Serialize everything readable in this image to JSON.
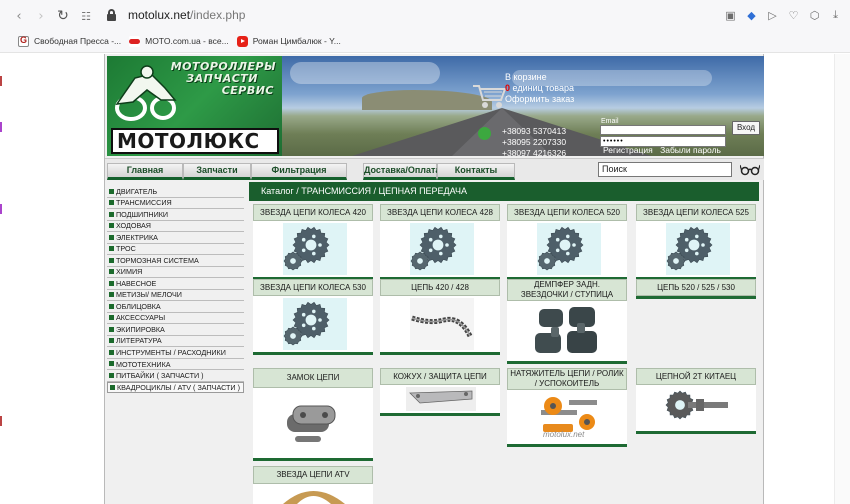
{
  "browser": {
    "url_host": "motolux.net",
    "url_path": "/index.php",
    "bookmarks": [
      {
        "label": "Свободная Пресса -...",
        "icon": "svpressa-favicon"
      },
      {
        "label": "MOTO.com.ua - все...",
        "icon": "moto-favicon"
      },
      {
        "label": "Роман Цимбалюк - Y...",
        "icon": "youtube-favicon"
      }
    ],
    "icons": [
      "camera-icon",
      "shield-icon",
      "play-icon",
      "heart-icon",
      "cube-icon",
      "download-icon"
    ]
  },
  "header": {
    "logo_line1": "МОТОРОЛЛЕРЫ",
    "logo_line2": "ЗАПЧАСТИ",
    "logo_line3": "СЕРВИС",
    "logo_word": "МОТОЛЮКС",
    "basket": {
      "title": "В корзине",
      "count": "0",
      "items_text": " единиц товара",
      "checkout": "Оформить заказ"
    },
    "phones": [
      "+38093 5370413",
      "+38095 2207330",
      "+38097 4216326"
    ],
    "login": {
      "email_label": "Email",
      "password_value": "••••••",
      "login_button": "Вход",
      "register": "Регистрация",
      "forgot": "Забыли пароль"
    }
  },
  "nav": {
    "items": [
      "Главная",
      "Запчасти",
      "Фильтрация",
      "Доставка/Оплата",
      "Контакты"
    ],
    "search_placeholder": "Поиск"
  },
  "sidebar": {
    "items": [
      "ДВИГАТЕЛЬ",
      "ТРАНСМИССИЯ",
      "ПОДШИПНИКИ",
      "ХОДОВАЯ",
      "ЭЛЕКТРИКА",
      "ТРОС",
      "ТОРМОЗНАЯ СИСТЕМА",
      "ХИМИЯ",
      "НАВЕСНОЕ",
      "МЕТИЗЫ/ МЕЛОЧИ",
      "ОБЛИЦОВКА",
      "АКСЕССУАРЫ",
      "ЭКИПИРОВКА",
      "ЛИТЕРАТУРА",
      "ИНСТРУМЕНТЫ / РАСХОДНИКИ",
      "МОТОТЕХНИКА",
      "ПИТБАЙКИ ( ЗАПЧАСТИ )",
      "КВАДРОЦИКЛЫ / ATV ( ЗАПЧАСТИ )"
    ]
  },
  "breadcrumb": "Каталог /  ТРАНСМИССИЯ /  ЦЕПНАЯ ПЕРЕДАЧА",
  "products": [
    {
      "title": "ЗВЕЗДА ЦЕПИ КОЛЕСА 420",
      "image": "sprocket-image"
    },
    {
      "title": "ЗВЕЗДА ЦЕПИ КОЛЕСА 428",
      "image": "sprocket-image"
    },
    {
      "title": "ЗВЕЗДА ЦЕПИ КОЛЕСА 520",
      "image": "sprocket-image"
    },
    {
      "title": "ЗВЕЗДА ЦЕПИ КОЛЕСА 525",
      "image": "sprocket-image"
    },
    {
      "title": "ЗВЕЗДА ЦЕПИ КОЛЕСА 530",
      "image": "sprocket-image"
    },
    {
      "title": "ЦЕПЬ 420 / 428",
      "image": "chain-image"
    },
    {
      "title": "ДЕМПФЕР ЗАДН. ЗВЕЗДОЧКИ / СТУПИЦА",
      "image": "damper-image"
    },
    {
      "title": "ЦЕПЬ 520 / 525 / 530",
      "image": ""
    },
    {
      "title": "ЗАМОК ЦЕПИ",
      "image": "chain-lock-image"
    },
    {
      "title": "КОЖУХ / ЗАЩИТА ЦЕПИ",
      "image": "chain-guard-image"
    },
    {
      "title": "НАТЯЖИТЕЛЬ ЦЕПИ / РОЛИК / УСПОКОИТЕЛЬ",
      "image": "tensioner-image",
      "watermark": "motolux.net"
    },
    {
      "title": "ЦЕПНОЙ 2Т КИТАЕЦ",
      "image": "gear-shaft-image"
    },
    {
      "title": "ЗВЕЗДА ЦЕПИ ATV",
      "image": "atv-sprocket-image"
    }
  ],
  "colors": {
    "brand_green": "#1a5e2d",
    "title_bg": "#d7e5d4",
    "basket_count": "#e20000"
  }
}
